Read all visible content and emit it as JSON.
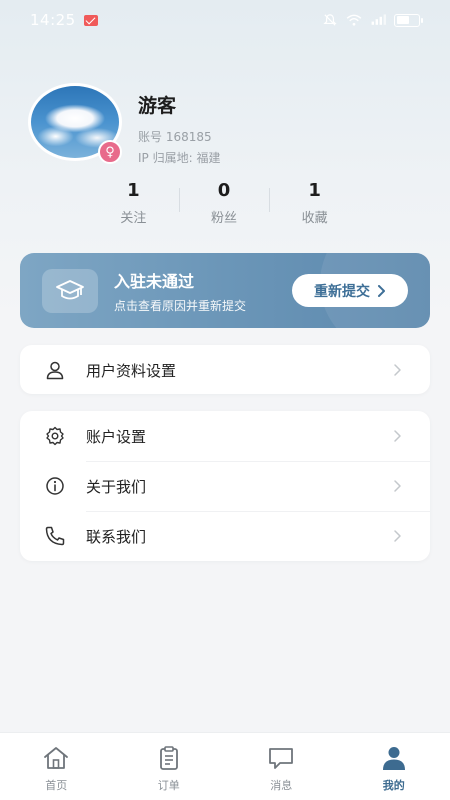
{
  "status_bar": {
    "time": "14:25"
  },
  "profile": {
    "nickname": "游客",
    "account_id": "账号 168185",
    "ip_location": "IP 归属地:  福建",
    "gender_symbol": "♀"
  },
  "stats": [
    {
      "value": "1",
      "label": "关注"
    },
    {
      "value": "0",
      "label": "粉丝"
    },
    {
      "value": "1",
      "label": "收藏"
    }
  ],
  "banner": {
    "title": "入驻未通过",
    "subtitle": "点击查看原因并重新提交",
    "button_label": "重新提交"
  },
  "menu": {
    "profile_settings": "用户资料设置",
    "account_settings": "账户设置",
    "about_us": "关于我们",
    "contact_us": "联系我们"
  },
  "tabbar": {
    "items": [
      {
        "label": "首页",
        "icon": "home-icon"
      },
      {
        "label": "订单",
        "icon": "order-icon"
      },
      {
        "label": "消息",
        "icon": "message-icon"
      },
      {
        "label": "我的",
        "icon": "profile-icon"
      }
    ],
    "active_index": 3
  },
  "colors": {
    "accent": "#3d6b90",
    "banner": "#6b96b8",
    "gender_badge": "#e86b8b"
  }
}
